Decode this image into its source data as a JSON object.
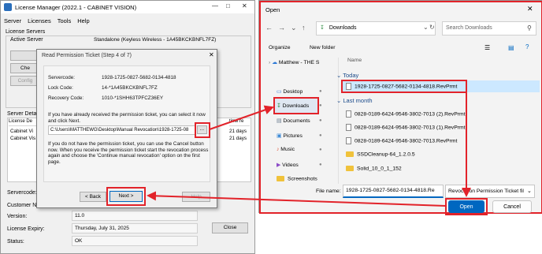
{
  "license_manager": {
    "title": "License Manager (2022.1 - CABINET VISION)",
    "menu": [
      "Server",
      "Licenses",
      "Tools",
      "Help"
    ],
    "license_servers_label": "License Servers",
    "active_server_label": "Active Server",
    "active_server_value": "Standalone (Keyless Wireless - 1A45BKCKBNFL7FZ)",
    "buttons_left": [
      "Che",
      "Config"
    ],
    "server_details_label": "Server Detail",
    "list_header_left": "License De",
    "list_header_right": "time re",
    "list_rows_left": [
      "Cabinet Vi",
      "Cabinet Vis"
    ],
    "list_rows_right": [
      "21 days",
      "21 days"
    ],
    "servercode_label": "Servercode:",
    "customer_label": "Customer Na",
    "version_label": "Version:",
    "version_value": "11.0",
    "expiry_label": "License Expiry:",
    "expiry_value": "Thursday, July 31, 2025",
    "status_label": "Status:",
    "status_value": "OK",
    "close_button": "Close"
  },
  "permission_dialog": {
    "title": "Read Permission Ticket  (Step 4 of 7)",
    "servercode_label": "Servercode:",
    "servercode_value": "1928-1725-0827-5682-0134-4818",
    "lockcode_label": "Lock Code:",
    "lockcode_value": "14-*1A45BKCKBNFL7FZ",
    "recovery_label": "Recovery Code:",
    "recovery_value": "1010-*1SHH63TPFCZ36EY",
    "text1": "If you have already received the permission ticket, you can select it now and click Next.",
    "path_value": "C:\\Users\\MATTHEWG\\Desktop\\Manual Revocation\\1928-1725-08",
    "browse_label": "...",
    "text2": "If you do not have the permission ticket, you can use the Cancel button now. When you receive the permission ticket start the revocation process again and choose the 'Continue manual revocation' option on the first page.",
    "back_button": "< Back",
    "next_button": "Next >",
    "help_button": "Help"
  },
  "open_dialog": {
    "title": "Open",
    "breadcrumb": "Downloads",
    "search_placeholder": "Search Downloads",
    "organize_label": "Organize",
    "new_folder_label": "New folder",
    "name_header": "Name",
    "sidebar": [
      "Matthew - THE S",
      "Desktop",
      "Downloads",
      "Documents",
      "Pictures",
      "Music",
      "Videos",
      "Screenshots"
    ],
    "today_label": "Today",
    "today_files": [
      "1928-1725-0827-5682-0134-4818.RevPrmt"
    ],
    "last_month_label": "Last month",
    "last_month_files": [
      "0828-0189-6424-9546-3802-7013 (2).RevPrmt",
      "0828-0189-6424-9546-3802-7013 (1).RevPrmt",
      "0828-0189-6424-9546-3802-7013.RevPrmt"
    ],
    "folders": [
      "SSDCleanup-64_1.2.0.5",
      "Solid_10_0_1_152"
    ],
    "filename_label": "File name:",
    "filename_value": "1928-1725-0827-5682-0134-4818.Re",
    "filetype_value": "Revocation Permission Ticket fil",
    "open_button": "Open",
    "cancel_button": "Cancel"
  },
  "colors": {
    "highlight_red": "#e2232a",
    "selection_blue": "#cce8ff",
    "accent": "#0067c0"
  }
}
